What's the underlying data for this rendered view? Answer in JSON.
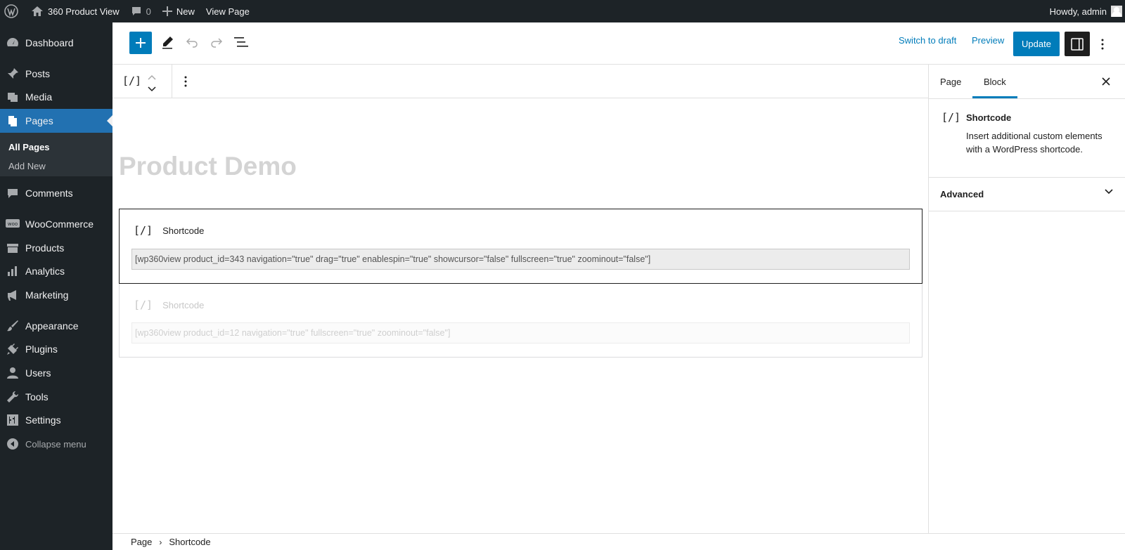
{
  "admin_bar": {
    "site_name": "360 Product View",
    "comments_count": "0",
    "new_label": "New",
    "view_page_label": "View Page",
    "howdy": "Howdy, admin"
  },
  "sidebar": {
    "items": [
      {
        "label": "Dashboard",
        "icon": "dashboard-icon"
      },
      {
        "label": "Posts",
        "icon": "pin-icon"
      },
      {
        "label": "Media",
        "icon": "media-icon"
      },
      {
        "label": "Pages",
        "icon": "pages-icon"
      },
      {
        "label": "Comments",
        "icon": "comment-icon"
      },
      {
        "label": "WooCommerce",
        "icon": "woo-icon"
      },
      {
        "label": "Products",
        "icon": "archive-icon"
      },
      {
        "label": "Analytics",
        "icon": "bar-chart-icon"
      },
      {
        "label": "Marketing",
        "icon": "megaphone-icon"
      },
      {
        "label": "Appearance",
        "icon": "brush-icon"
      },
      {
        "label": "Plugins",
        "icon": "plug-icon"
      },
      {
        "label": "Users",
        "icon": "user-icon"
      },
      {
        "label": "Tools",
        "icon": "wrench-icon"
      },
      {
        "label": "Settings",
        "icon": "sliders-icon"
      }
    ],
    "submenu": {
      "all_pages": "All Pages",
      "add_new": "Add New"
    },
    "collapse_label": "Collapse menu"
  },
  "header": {
    "switch_to_draft": "Switch to draft",
    "preview": "Preview",
    "update": "Update"
  },
  "editor": {
    "title": "Product Demo",
    "blocks": [
      {
        "icon_glyph": "[/]",
        "label": "Shortcode",
        "value": "[wp360view product_id=343 navigation=\"true\" drag=\"true\" enablespin=\"true\" showcursor=\"false\" fullscreen=\"true\" zoominout=\"false\"]"
      },
      {
        "icon_glyph": "[/]",
        "label": "Shortcode",
        "value": "[wp360view product_id=12 navigation=\"true\" fullscreen=\"true\" zoominout=\"false\"]"
      }
    ],
    "toolbar_icon_glyph": "[/]"
  },
  "breadcrumb": {
    "root": "Page",
    "current": "Shortcode"
  },
  "settings_panel": {
    "tab_page": "Page",
    "tab_block": "Block",
    "block_icon_glyph": "[/]",
    "block_title": "Shortcode",
    "block_description": "Insert additional custom elements with a WordPress shortcode.",
    "advanced": "Advanced"
  },
  "colors": {
    "admin_bg": "#1d2327",
    "accent": "#007cba",
    "current_menu": "#2271b1"
  }
}
